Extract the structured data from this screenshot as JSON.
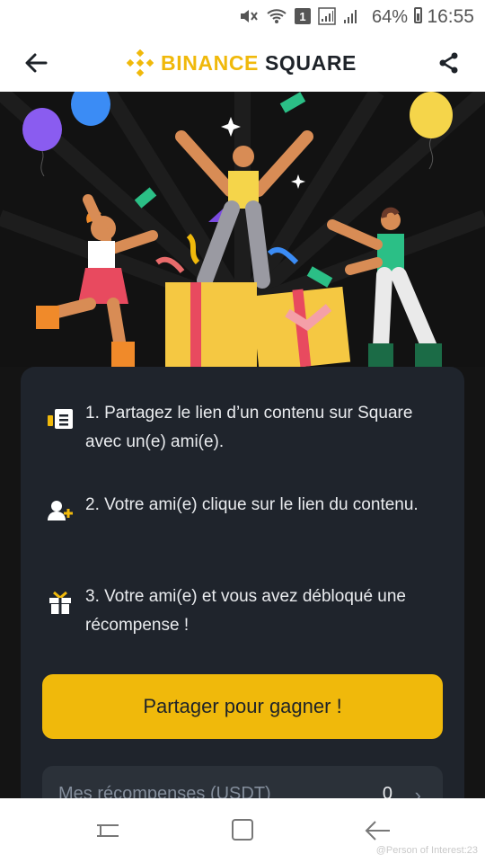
{
  "status_bar": {
    "battery_percent": "64%",
    "time": "16:55",
    "sim_badge": "1",
    "icons": [
      "mute-icon",
      "wifi-icon",
      "sim-badge-icon",
      "signal-icon",
      "signal-icon",
      "battery-icon"
    ]
  },
  "header": {
    "logo_word1": "BINANCE",
    "logo_word2": "SQUARE",
    "back_icon": "arrow-left-icon",
    "share_icon": "share-icon"
  },
  "colors": {
    "brand": "#F0B90B",
    "card_bg": "#1f242c",
    "page_bg": "#141414",
    "text_light": "#eaecef",
    "muted": "#848e9c"
  },
  "steps": [
    {
      "icon": "document-icon",
      "text": "1. Partagez le lien d’un contenu sur Square avec un(e) ami(e)."
    },
    {
      "icon": "add-user-icon",
      "text": "2. Votre ami(e) clique sur le lien du contenu."
    },
    {
      "icon": "gift-icon",
      "text": "3. Votre ami(e) et vous avez débloqué une récompense !"
    }
  ],
  "cta": {
    "label": "Partager pour gagner !"
  },
  "rewards": {
    "label": "Mes récompenses (USDT)",
    "value": "0",
    "chevron": "chevron-right-icon"
  },
  "nav": {
    "icons": [
      "recent-apps-icon",
      "home-icon",
      "back-icon"
    ]
  },
  "watermark": "@Person of Interest:23"
}
